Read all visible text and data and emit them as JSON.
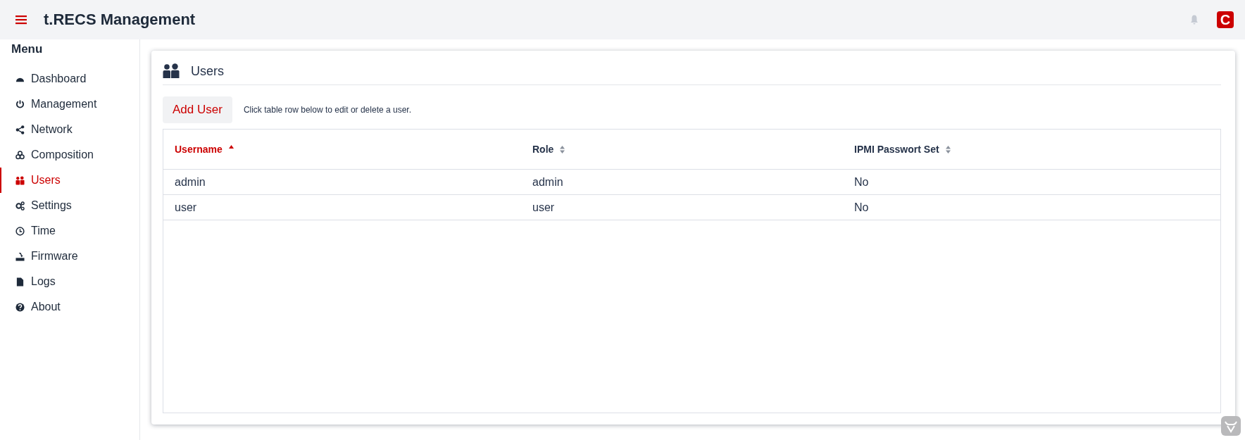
{
  "header": {
    "title": "t.RECS Management",
    "logo_letter": "C"
  },
  "sidebar": {
    "title": "Menu",
    "items": [
      {
        "label": "Dashboard",
        "selected": false
      },
      {
        "label": "Management",
        "selected": false
      },
      {
        "label": "Network",
        "selected": false
      },
      {
        "label": "Composition",
        "selected": false
      },
      {
        "label": "Users",
        "selected": true
      },
      {
        "label": "Settings",
        "selected": false
      },
      {
        "label": "Time",
        "selected": false
      },
      {
        "label": "Firmware",
        "selected": false
      },
      {
        "label": "Logs",
        "selected": false
      },
      {
        "label": "About",
        "selected": false
      }
    ]
  },
  "card": {
    "title": "Users",
    "add_button": "Add User",
    "hint": "Click table row below to edit or delete a user."
  },
  "table": {
    "columns": [
      {
        "label": "Username",
        "selected": true,
        "sorted": true
      },
      {
        "label": "Role",
        "selected": false,
        "sorted": false
      },
      {
        "label": "IPMI Passwort Set",
        "selected": false,
        "sorted": false
      }
    ],
    "rows": [
      [
        "admin",
        "admin",
        "No"
      ],
      [
        "user",
        "user",
        "No"
      ]
    ]
  }
}
